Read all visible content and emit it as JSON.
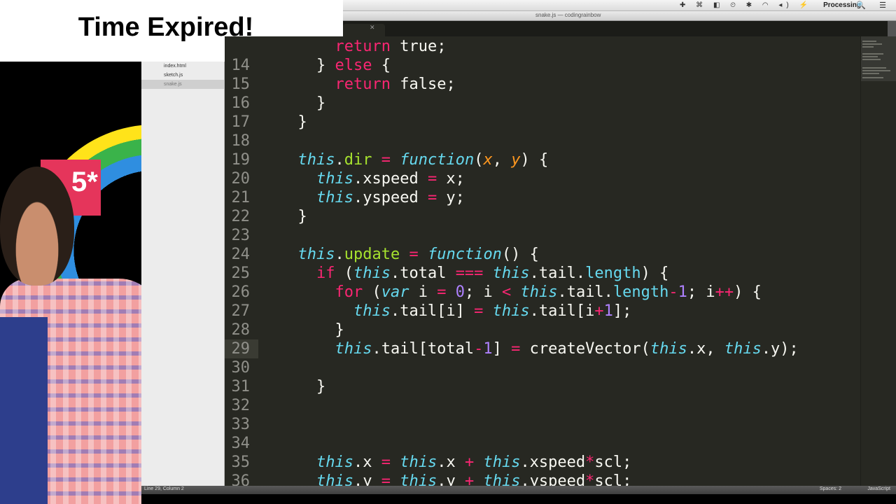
{
  "overlay": {
    "title": "Time Expired!"
  },
  "menubar": {
    "app_name": "Processing",
    "tray_icons": "✚ ⌘ ◧ ⏲ ✱ ◠ ◂) ⚡",
    "right_icons": "🔍 ☰"
  },
  "window": {
    "title": "snake.js — codingrainbow"
  },
  "sidebar": {
    "files": [
      {
        "name": "index.html",
        "selected": false
      },
      {
        "name": "sketch.js",
        "selected": false
      },
      {
        "name": "snake.js",
        "selected": true
      }
    ]
  },
  "video": {
    "badge_text": "5*"
  },
  "editor": {
    "current_line": 29,
    "lines": [
      {
        "n": "",
        "code": "      return true;"
      },
      {
        "n": "14",
        "code": "    } else {"
      },
      {
        "n": "15",
        "code": "      return false;"
      },
      {
        "n": "16",
        "code": "    }"
      },
      {
        "n": "17",
        "code": "  }"
      },
      {
        "n": "18",
        "code": ""
      },
      {
        "n": "19",
        "code": "  this.dir = function(x, y) {"
      },
      {
        "n": "20",
        "code": "    this.xspeed = x;"
      },
      {
        "n": "21",
        "code": "    this.yspeed = y;"
      },
      {
        "n": "22",
        "code": "  }"
      },
      {
        "n": "23",
        "code": ""
      },
      {
        "n": "24",
        "code": "  this.update = function() {"
      },
      {
        "n": "25",
        "code": "    if (this.total === this.tail.length) {"
      },
      {
        "n": "26",
        "code": "      for (var i = 0; i < this.tail.length-1; i++) {"
      },
      {
        "n": "27",
        "code": "        this.tail[i] = this.tail[i+1];"
      },
      {
        "n": "28",
        "code": "      }"
      },
      {
        "n": "29",
        "code": "      this.tail[total-1] = createVector(this.x, this.y);"
      },
      {
        "n": "30",
        "code": ""
      },
      {
        "n": "31",
        "code": "    }"
      },
      {
        "n": "32",
        "code": ""
      },
      {
        "n": "33",
        "code": ""
      },
      {
        "n": "34",
        "code": ""
      },
      {
        "n": "35",
        "code": "    this.x = this.x + this.xspeed*scl;"
      },
      {
        "n": "36",
        "code": "    this.y = this.y + this.yspeed*scl;"
      }
    ]
  },
  "statusbar": {
    "left": "Line 29, Column 2",
    "spaces": "Spaces: 2",
    "syntax": "JavaScript"
  },
  "colors": {
    "editor_bg": "#272822",
    "keyword": "#f92672",
    "this": "#66d9ef",
    "function_name": "#a6e22e",
    "param": "#fd971f",
    "number": "#ae81ff"
  }
}
